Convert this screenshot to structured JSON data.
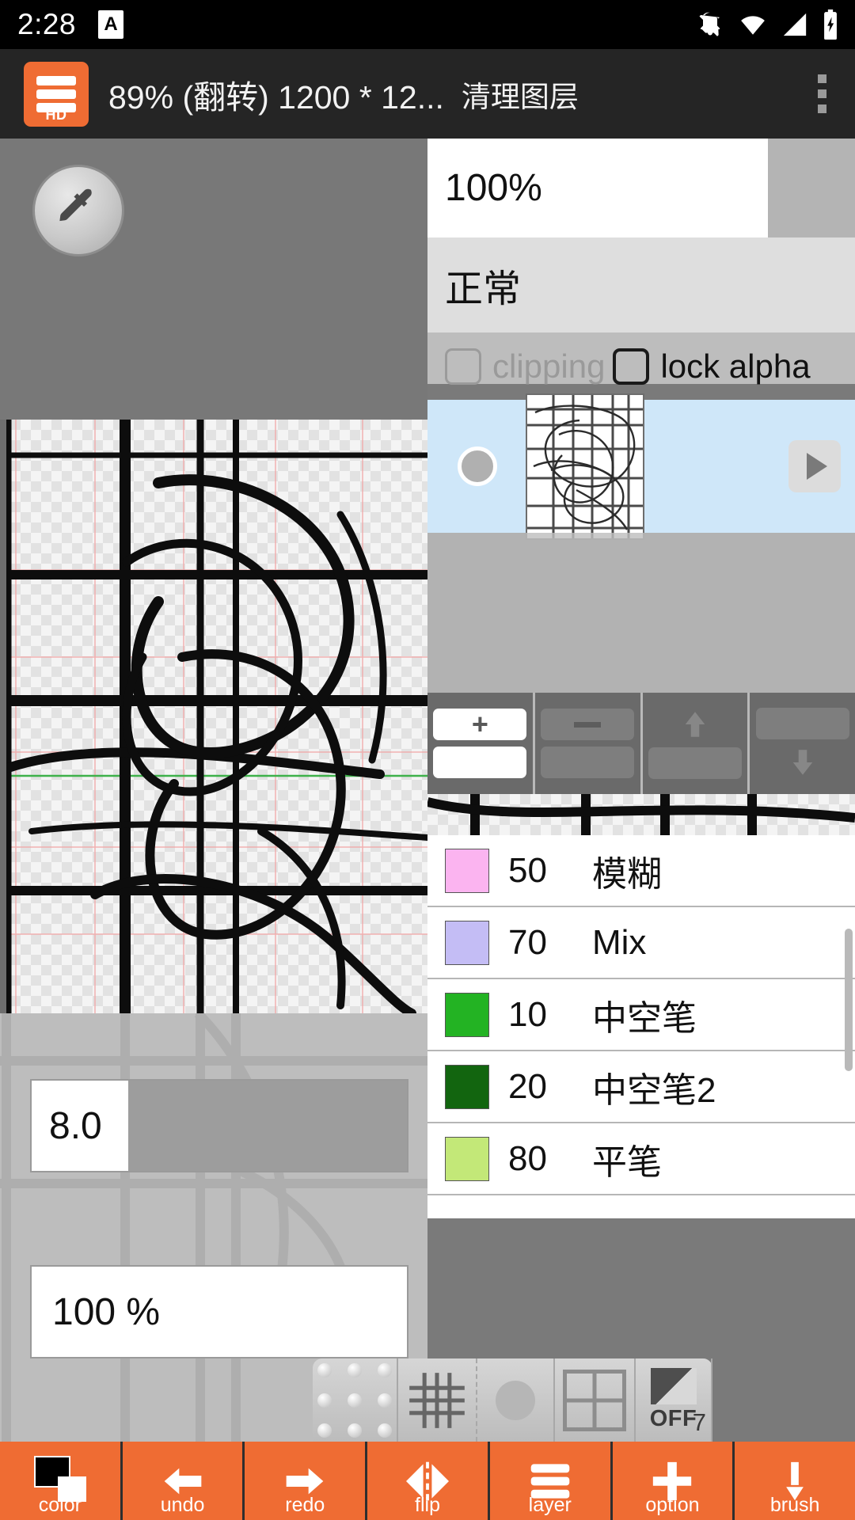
{
  "statusbar": {
    "time": "2:28",
    "app_badge": "A",
    "icons": [
      "notifications-off-icon",
      "wifi-icon",
      "signal-icon",
      "battery-charging-icon"
    ]
  },
  "appbar": {
    "badge_text": "HD",
    "title": "89% (翻转) 1200 * 12...",
    "action": "清理图层",
    "overflow": "overflow-menu-icon"
  },
  "layer_panel": {
    "opacity": "100%",
    "blend_mode": "正常",
    "clipping_label": "clipping",
    "lock_alpha_label": "lock alpha",
    "clipping_checked": false,
    "lock_alpha_checked": false,
    "selected_row_color": "#cfe7f9",
    "buttons": [
      {
        "name": "add-layer-button",
        "glyph": "+"
      },
      {
        "name": "delete-layer-button",
        "glyph": "−"
      },
      {
        "name": "move-layer-up-button",
        "glyph": "↑"
      },
      {
        "name": "move-layer-down-button",
        "glyph": "↓"
      }
    ]
  },
  "brushes": [
    {
      "num": "50",
      "name": "模糊",
      "color": "#fbb4f0"
    },
    {
      "num": "70",
      "name": "Mix",
      "color": "#c4bdf5"
    },
    {
      "num": "10",
      "name": "中空笔",
      "color": "#23b323"
    },
    {
      "num": "20",
      "name": "中空笔2",
      "color": "#12650f"
    },
    {
      "num": "80",
      "name": "平笔",
      "color": "#c3e878"
    }
  ],
  "brush_controls": {
    "size": "8.0",
    "opacity": "100 %"
  },
  "floatbar": {
    "items": [
      {
        "name": "dot-grid-icon",
        "label": ""
      },
      {
        "name": "grid-icon",
        "label": ""
      },
      {
        "name": "circle-icon",
        "label": ""
      },
      {
        "name": "quad-split-icon",
        "label": ""
      },
      {
        "name": "symmetry-off-toggle",
        "label": "OFF"
      },
      {
        "name": "stabilizer-icon",
        "label": "7"
      }
    ]
  },
  "bottombar": {
    "items": [
      {
        "name": "color-button",
        "label": "color"
      },
      {
        "name": "undo-button",
        "label": "undo"
      },
      {
        "name": "redo-button",
        "label": "redo"
      },
      {
        "name": "flip-button",
        "label": "flip"
      },
      {
        "name": "layer-button",
        "label": "layer"
      },
      {
        "name": "option-button",
        "label": "option"
      },
      {
        "name": "brush-button",
        "label": "brush"
      }
    ]
  },
  "colors": {
    "accent_orange": "#ef6c33",
    "appbar_dark": "#252525",
    "selected_layer_blue": "#cfe7f9"
  }
}
